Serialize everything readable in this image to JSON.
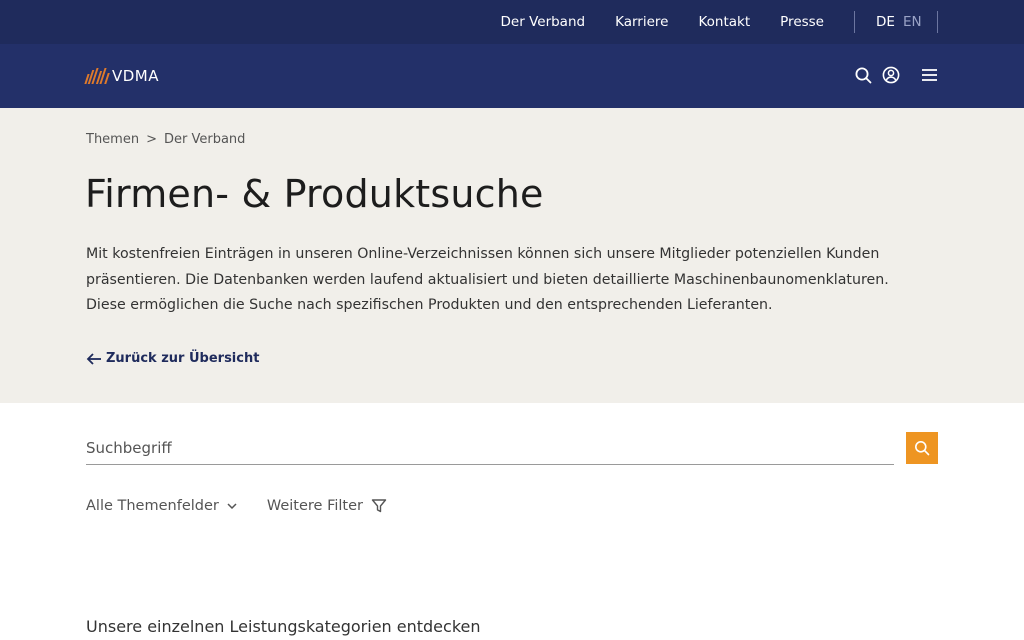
{
  "topbar": {
    "links": [
      "Der Verband",
      "Karriere",
      "Kontakt",
      "Presse"
    ],
    "lang_de": "DE",
    "lang_en": "EN"
  },
  "logo": {
    "text": "VDMA"
  },
  "colors": {
    "topbar_bg": "#1f2b5c",
    "nav_bg": "#233069",
    "hero_bg": "#f1efea",
    "accent_orange": "#ee9522",
    "logo_mark": "#e07a2b"
  },
  "icons": {
    "search": "search-icon",
    "account": "user-circle-icon",
    "menu": "hamburger-menu-icon",
    "back": "arrow-left-icon",
    "dropdown": "chevron-down-icon",
    "filter": "funnel-icon"
  },
  "breadcrumb": {
    "items": [
      "Themen",
      "Der Verband"
    ],
    "separator": ">"
  },
  "page": {
    "title": "Firmen- & Produktsuche",
    "intro": "Mit kostenfreien Einträgen in unseren Online-Verzeichnissen können sich unsere Mitglieder potenziellen Kunden präsentieren. Die Datenbanken werden laufend aktualisiert und bieten detaillierte Maschinenbaunomenklaturen. Diese ermöglichen die Suche nach spezifischen Produkten und den entsprechenden Lieferanten.",
    "back_link": "Zurück zur Übersicht"
  },
  "search": {
    "placeholder": "Suchbegriff",
    "value": ""
  },
  "filters": {
    "topics": "Alle Themenfelder",
    "more": "Weitere Filter"
  },
  "section": {
    "heading": "Unsere einzelnen Leistungskategorien entdecken"
  }
}
